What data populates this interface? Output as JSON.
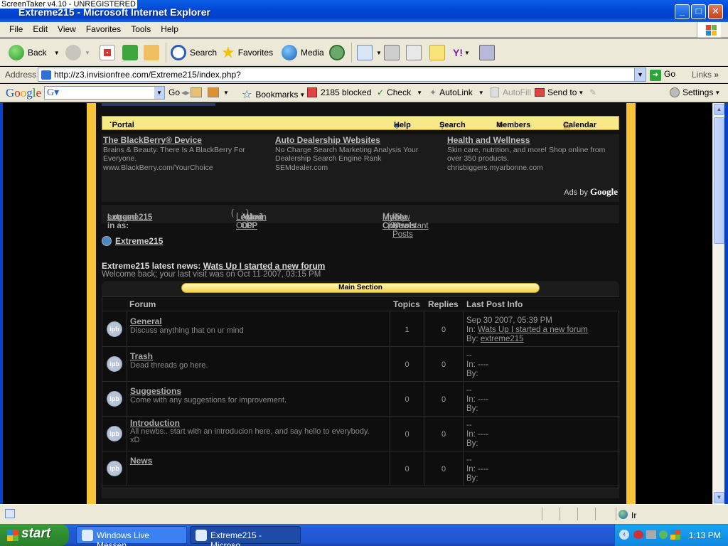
{
  "window": {
    "watermark": "ScreenTaker v4.10 - UNREGISTERED",
    "title": "Extreme215 - Microsoft Internet Explorer"
  },
  "menu": [
    "File",
    "Edit",
    "View",
    "Favorites",
    "Tools",
    "Help"
  ],
  "toolbar": {
    "back": "Back",
    "search": "Search",
    "favorites": "Favorites",
    "media": "Media"
  },
  "address": {
    "label": "Address",
    "url": "http://z3.invisionfree.com/Extreme215/index.php?",
    "go": "Go",
    "links": "Links"
  },
  "googlebar": {
    "logo": "Google",
    "go": "Go",
    "bookmarks": "Bookmarks",
    "blocked": "2185 blocked",
    "check": "Check",
    "autolink": "AutoLink",
    "autofill": "AutoFill",
    "sendto": "Send to",
    "settings": "Settings"
  },
  "nav": {
    "portal": "Portal",
    "help": "Help",
    "search": "Search",
    "members": "Members",
    "calendar": "Calendar"
  },
  "ads": [
    {
      "title": "The BlackBerry® Device",
      "text": "Brains & Beauty. There Is A BlackBerry For Everyone.",
      "url": "www.BlackBerry.com/YourChoice"
    },
    {
      "title": "Auto Dealership Websites",
      "text": "No Charge Search Marketing Analysis Your Dealership Search Engine Rank",
      "url": "SEMdealer.com"
    },
    {
      "title": "Health and Wellness",
      "text": "Skin care, nutrition, and more! Shop online from over 350 products.",
      "url": "chrisbiggers.myarbonne.com"
    }
  ],
  "adsby": {
    "prefix": "Ads by",
    "brand": "Google"
  },
  "login": {
    "label": "Logged in as:",
    "user": "extreme215",
    "logout": "Log Out",
    "admincp": "Admin CP",
    "modcp": "Mod CP",
    "controls": "My Controls",
    "inbox": "Inbox (0)",
    "newposts": "View New Posts",
    "assistant": "My Assistant"
  },
  "breadcrumb": "Extreme215",
  "news": {
    "label": "Extreme215 latest news:",
    "link": "Wats Up I started a new forum"
  },
  "welcome": "Welcome back; your last visit was on Oct 11 2007, 03:15 PM",
  "section": "Main Section",
  "table": {
    "headers": {
      "forum": "Forum",
      "topics": "Topics",
      "replies": "Replies",
      "last": "Last Post Info"
    },
    "rows": [
      {
        "icon": "ipb",
        "name": "General",
        "desc": "Discuss anything that on ur mind",
        "topics": "1",
        "replies": "0",
        "last1": "Sep 30 2007, 05:39 PM",
        "last2": "In:",
        "last2link": "Wats Up I started a new forum",
        "last3": "By:",
        "last3link": "extreme215"
      },
      {
        "icon": "ipb",
        "name": "Trash",
        "desc": "Dead threads go here.",
        "topics": "0",
        "replies": "0",
        "last1": "--",
        "last2": "In: ----",
        "last2link": "",
        "last3": "By:",
        "last3link": ""
      },
      {
        "icon": "ipb",
        "name": "Suggestions",
        "desc": "Come with any suggestions for improvement.",
        "topics": "0",
        "replies": "0",
        "last1": "--",
        "last2": "In: ----",
        "last2link": "",
        "last3": "By:",
        "last3link": ""
      },
      {
        "icon": "ipb",
        "name": "Introduction",
        "desc": "All newbs.. start with an introducion here, and say hello to everybody. xD",
        "topics": "0",
        "replies": "0",
        "last1": "--",
        "last2": "In: ----",
        "last2link": "",
        "last3": "By:",
        "last3link": ""
      },
      {
        "icon": "ipb",
        "name": "News",
        "desc": "",
        "topics": "0",
        "replies": "0",
        "last1": "--",
        "last2": "In: ----",
        "last2link": "",
        "last3": "By:",
        "last3link": ""
      }
    ]
  },
  "statusbar": {
    "zone": "Ir"
  },
  "taskbar": {
    "start": "start",
    "tasks": [
      "Windows Live Messen...",
      "Extreme215 - Microso..."
    ],
    "clock": "1:13 PM"
  }
}
